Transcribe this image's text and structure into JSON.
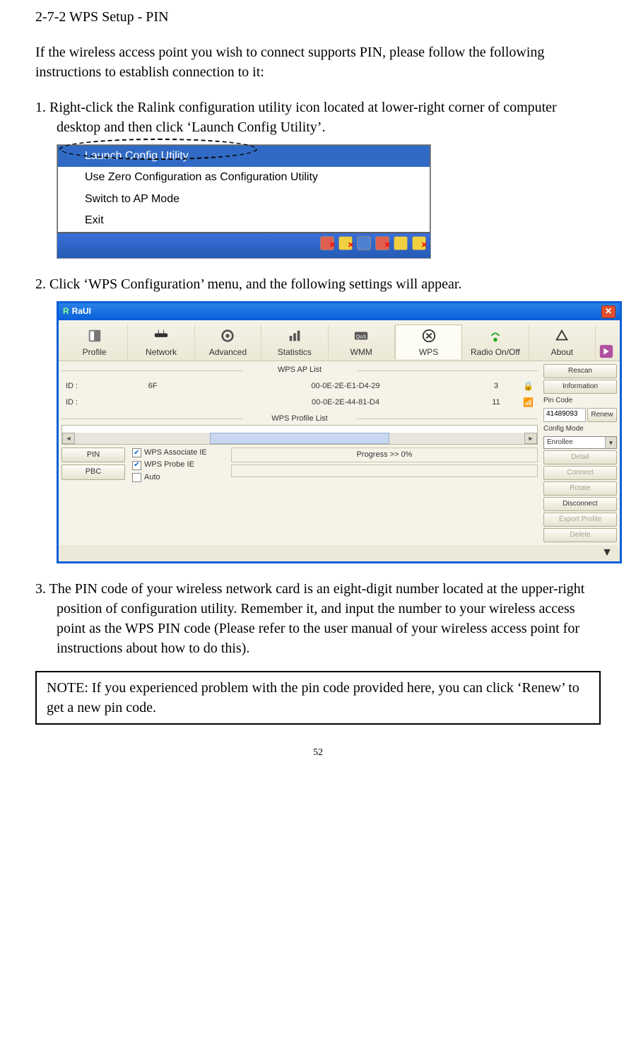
{
  "heading": "2-7-2 WPS Setup - PIN",
  "intro": "If the wireless access point you wish to connect supports PIN, please follow the following instructions to establish connection to it:",
  "steps": {
    "s1_num": "1.",
    "s1": "Right-click the Ralink configuration utility icon located at lower-right corner of computer desktop and then click ‘Launch Config Utility’.",
    "s2_num": "2.",
    "s2": "Click ‘WPS Configuration’ menu, and the following settings will appear.",
    "s3_num": "3.",
    "s3": "The PIN code of your wireless network card is an eight-digit number located at the upper-right position of configuration utility. Remember it, and input the number to your wireless access point as the WPS PIN code (Please refer to the user manual of your wireless access point for instructions about how to do this)."
  },
  "context_menu": {
    "items": [
      "Launch Config Utility",
      "Use Zero Configuration as Configuration Utility",
      "Switch to AP Mode",
      "Exit"
    ]
  },
  "raui": {
    "title": "RaUI",
    "toolbar": [
      "Profile",
      "Network",
      "Advanced",
      "Statistics",
      "WMM",
      "WPS",
      "Radio On/Off",
      "About"
    ],
    "ap_list_title": "WPS AP List",
    "ap_rows": [
      {
        "id": "ID :",
        "name": "6F",
        "mac": "00-0E-2E-E1-D4-29",
        "ch": "3",
        "locked": true
      },
      {
        "id": "ID :",
        "name": "",
        "mac": "00-0E-2E-44-81-D4",
        "ch": "11",
        "locked": false
      }
    ],
    "profile_list_title": "WPS Profile List",
    "buttons": {
      "pin": "PIN",
      "pbc": "PBC",
      "rescan": "Rescan",
      "information": "Information",
      "renew": "Renew",
      "detail": "Detail",
      "connect": "Connect",
      "rotate": "Rotate",
      "disconnect": "Disconnect",
      "export": "Export Profile",
      "delete": "Delete"
    },
    "checkboxes": {
      "assoc": "WPS Associate IE",
      "probe": "WPS Probe IE",
      "auto": "Auto"
    },
    "progress": "Progress >> 0%",
    "pin_code_label": "Pin Code",
    "pin_code": "41489093",
    "config_mode_label": "Config Mode",
    "config_mode": "Enrollee"
  },
  "note": "NOTE: If you experienced problem with the pin code provided here, you can click ‘Renew’ to get a new pin code.",
  "page_number": "52"
}
